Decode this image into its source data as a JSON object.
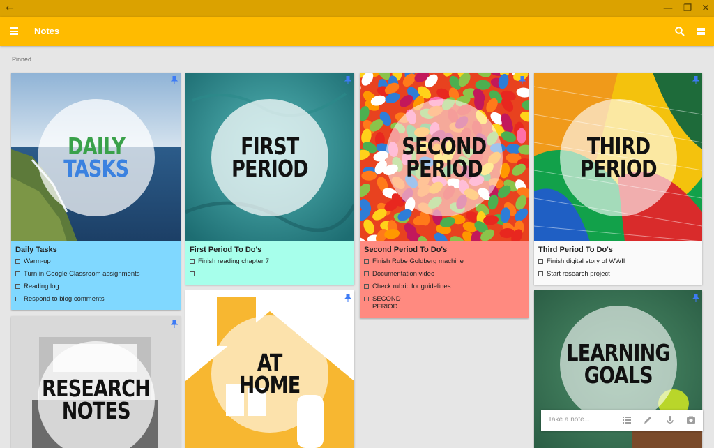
{
  "window": {
    "back_glyph": "←",
    "minimize_glyph": "—",
    "restore_glyph": "❐",
    "close_glyph": "✕"
  },
  "appbar": {
    "title": "Notes"
  },
  "section": {
    "label": "Pinned"
  },
  "cards": {
    "daily": {
      "circle_line1": "DAILY",
      "circle_line2": "TASKS",
      "title": "Daily Tasks",
      "items": [
        "Warm-up",
        "Turn in Google Classroom assignments",
        "Reading log",
        "Respond to blog comments"
      ],
      "bg": "#80d8ff"
    },
    "first": {
      "circle_line1": "FIRST",
      "circle_line2": "PERIOD",
      "title": "First Period To Do's",
      "items": [
        "Finish reading chapter 7",
        ""
      ],
      "bg": "#a7ffeb"
    },
    "second": {
      "circle_line1": "SECOND",
      "circle_line2": "PERIOD",
      "title": "Second Period To Do's",
      "items": [
        "Finish Rube Goldberg machine",
        "Documentation video",
        "Check rubric for guidelines",
        "SECOND PERIOD"
      ],
      "bg": "#ff8a80"
    },
    "third": {
      "circle_line1": "THIRD",
      "circle_line2": "PERIOD",
      "title": "Third Period To Do's",
      "items": [
        "Finish digital story of WWII",
        "Start research project"
      ],
      "bg": "#fafafa"
    },
    "research": {
      "circle_line1": "RESEARCH",
      "circle_line2": "NOTES"
    },
    "home": {
      "circle_line1": "AT",
      "circle_line2": "HOME"
    },
    "goals": {
      "circle_line1": "LEARNING",
      "circle_line2": "GOALS"
    }
  },
  "take_note": {
    "placeholder": "Take a note..."
  },
  "colors": {
    "titlebar": "#dba200",
    "appbar": "#ffbb00",
    "pin": "#3d7bf5"
  }
}
